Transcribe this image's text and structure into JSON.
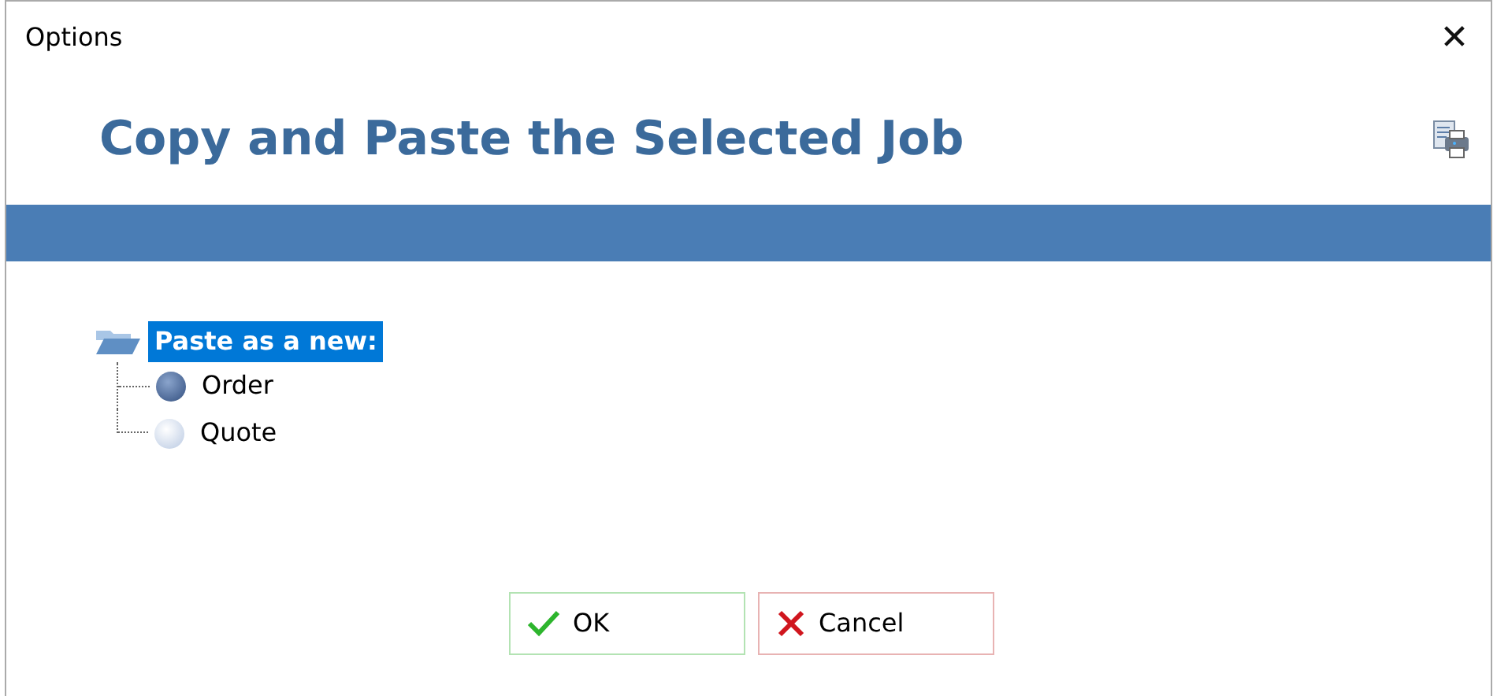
{
  "window": {
    "title": "Options",
    "close": "✕"
  },
  "header": {
    "title": "Copy and Paste the Selected Job"
  },
  "tree": {
    "label": "Paste as a new:",
    "selected": true,
    "expanded": true,
    "children": [
      {
        "label": "Order",
        "selected": true
      },
      {
        "label": "Quote",
        "selected": false
      }
    ]
  },
  "buttons": [
    {
      "label": "OK",
      "kind": "ok"
    },
    {
      "label": "Cancel",
      "kind": "cancel"
    }
  ]
}
